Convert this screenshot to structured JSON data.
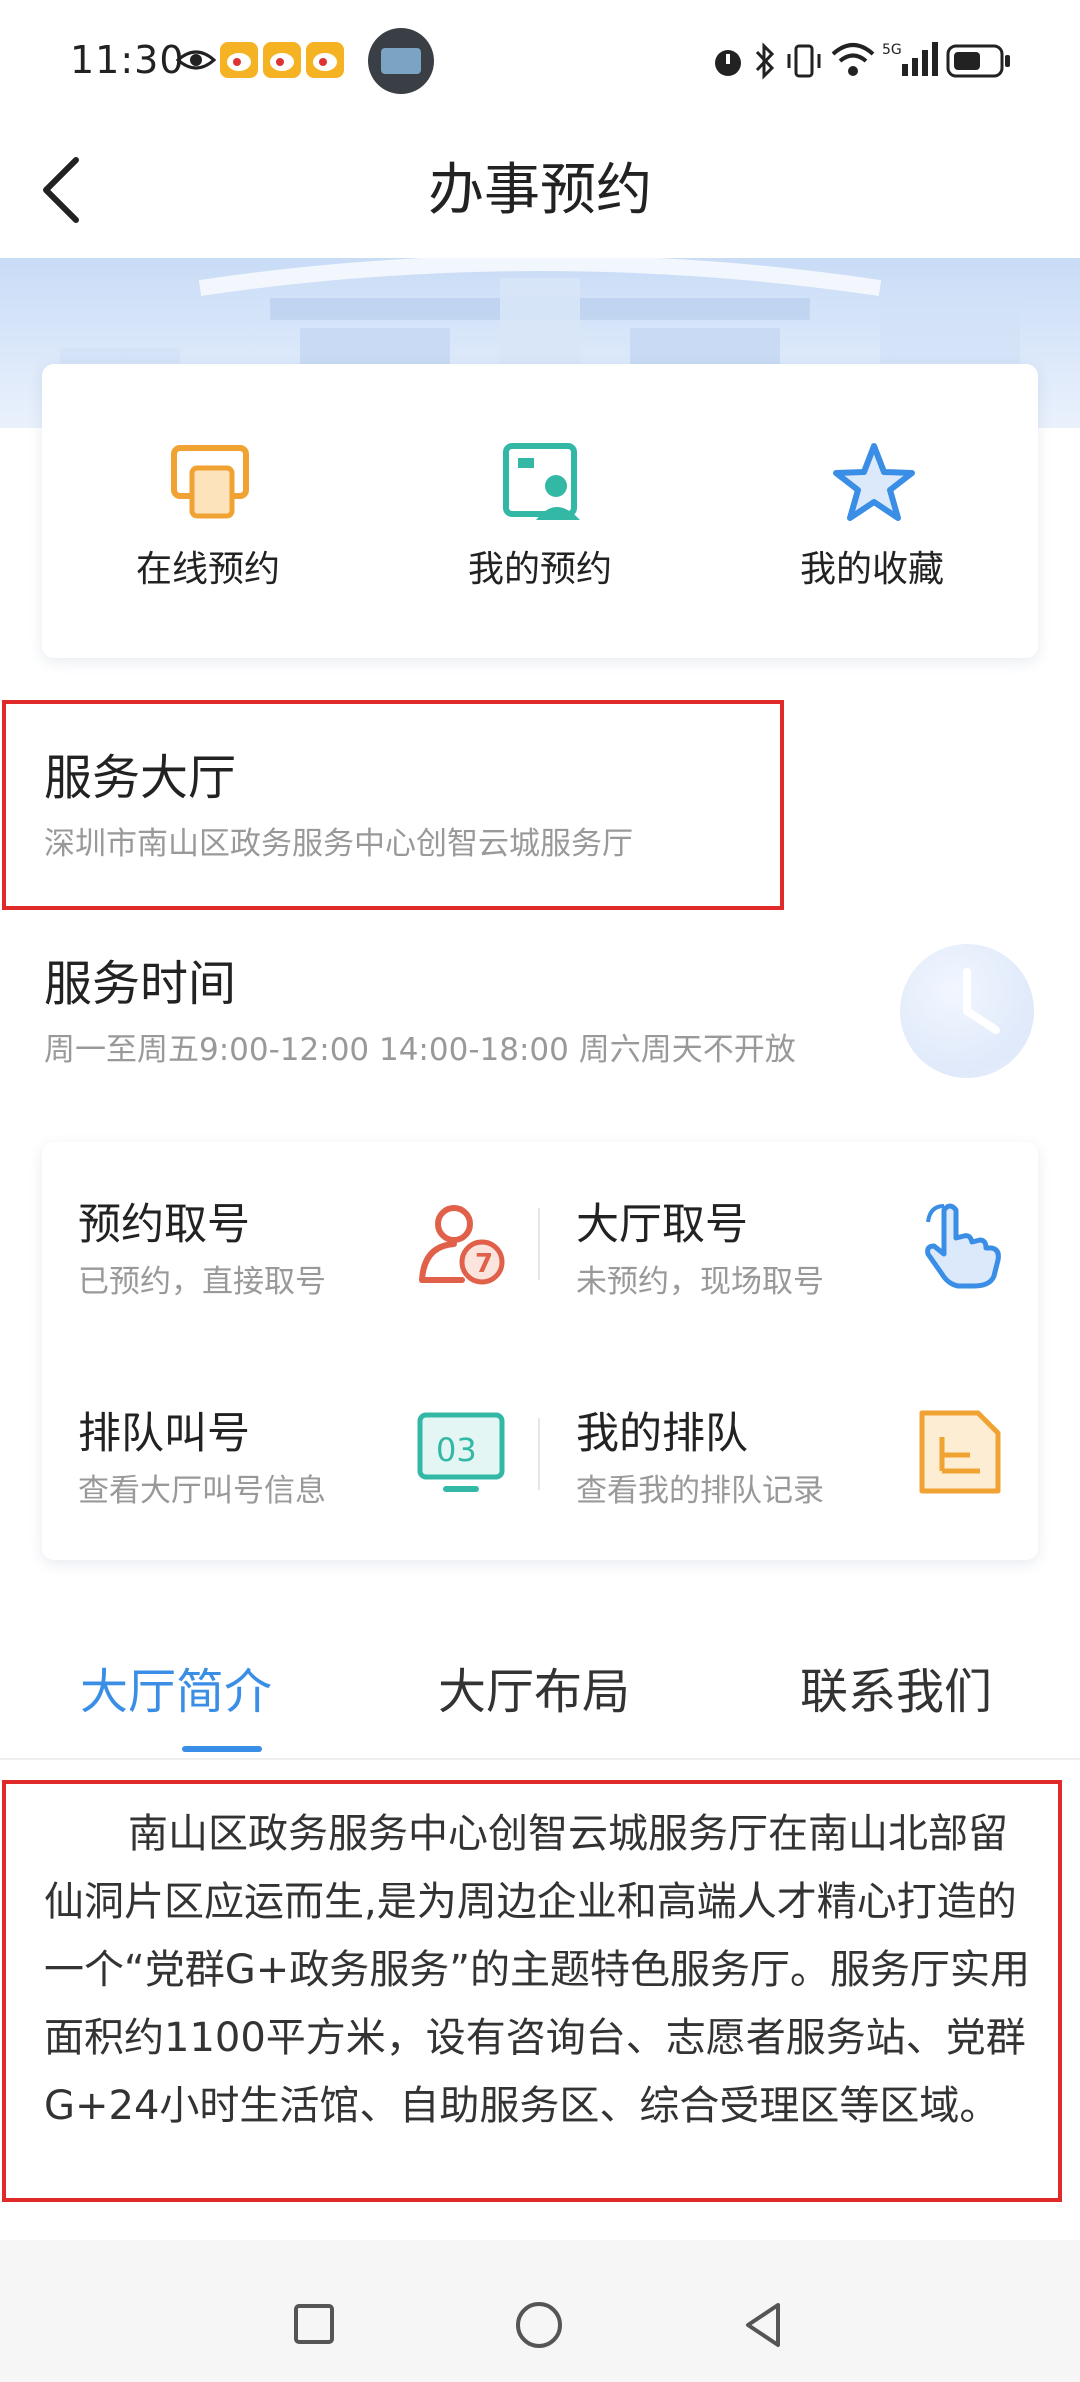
{
  "status_bar": {
    "time": "11:30",
    "icons": [
      "eye-icon",
      "weibo-icon",
      "weibo-icon",
      "weibo-icon",
      "app-avatar",
      "alarm-icon",
      "bluetooth-icon",
      "vibrate-icon",
      "wifi-icon",
      "5g-signal-icon",
      "battery-icon"
    ]
  },
  "header": {
    "title": "办事预约",
    "back_icon": "chevron-left-icon"
  },
  "quick_actions": [
    {
      "label": "在线预约",
      "icon": "online-booking-icon",
      "color": "#f0a232"
    },
    {
      "label": "我的预约",
      "icon": "my-booking-icon",
      "color": "#34b8a6"
    },
    {
      "label": "我的收藏",
      "icon": "star-icon",
      "color": "#3a8ee6"
    }
  ],
  "hall": {
    "title": "服务大厅",
    "name": "深圳市南山区政务服务中心创智云城服务厅"
  },
  "service_time": {
    "title": "服务时间",
    "value": "周一至周五9:00-12:00 14:00-18:00 周六周天不开放",
    "icon": "clock-icon"
  },
  "services": [
    {
      "title": "预约取号",
      "subtitle": "已预约，直接取号",
      "icon": "person-number-icon",
      "color": "#e0604a"
    },
    {
      "title": "大厅取号",
      "subtitle": "未预约，现场取号",
      "icon": "hand-tap-icon",
      "color": "#3a8ee6"
    },
    {
      "title": "排队叫号",
      "subtitle": "查看大厅叫号信息",
      "icon": "monitor-number-icon",
      "monitor_text": "03",
      "color": "#34b8a6"
    },
    {
      "title": "我的排队",
      "subtitle": "查看我的排队记录",
      "icon": "document-list-icon",
      "color": "#f0a232"
    }
  ],
  "tabs": [
    {
      "label": "大厅简介",
      "active": true
    },
    {
      "label": "大厅布局",
      "active": false
    },
    {
      "label": "联系我们",
      "active": false
    }
  ],
  "intro": "南山区政务服务中心创智云城服务厅在南山北部留仙洞片区应运而生,是为周边企业和高端人才精心打造的一个“党群G+政务服务”的主题特色服务厅。服务厅实用面积约1100平方米，设有咨询台、志愿者服务站、党群G+24小时生活馆、自助服务区、综合受理区等区域。",
  "nav_bar": {
    "icons": [
      "recents-square-icon",
      "home-circle-icon",
      "back-triangle-icon"
    ]
  },
  "colors": {
    "accent": "#3a8ee6",
    "highlight_border": "#e02a2a"
  }
}
